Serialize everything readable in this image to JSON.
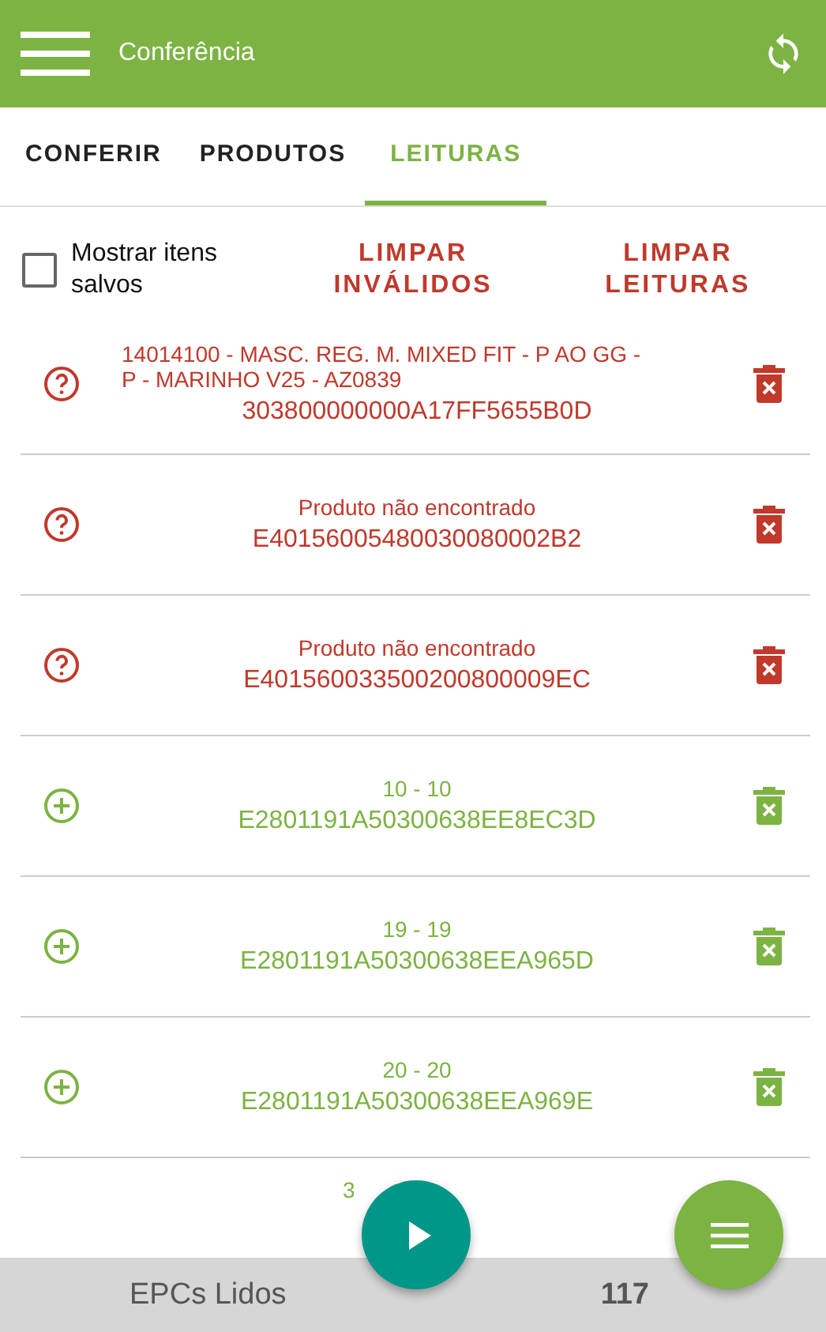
{
  "app_bar": {
    "title": "Conferência"
  },
  "tabs": [
    {
      "label": "CONFERIR",
      "selected": false
    },
    {
      "label": "PRODUTOS",
      "selected": false
    },
    {
      "label": "LEITURAS",
      "selected": true
    }
  ],
  "show_saved": {
    "label": "Mostrar itens salvos",
    "checked": false
  },
  "actions": [
    "LIMPAR INVÁLIDOS",
    "LIMPAR LEITURAS"
  ],
  "readings": [
    {
      "kind": "invalid",
      "title": "14014100 - MASC. REG. M. MIXED FIT - P AO GG - P - MARINHO V25 - AZ0839",
      "epc": "303800000000A17FF5655B0D"
    },
    {
      "kind": "invalid",
      "title": "Produto não encontrado",
      "epc": "E40156005480030080002B2"
    },
    {
      "kind": "invalid",
      "title": "Produto não encontrado",
      "epc": "E401560033500200800009EC"
    },
    {
      "kind": "valid",
      "title": "10 - 10",
      "epc": "E2801191A50300638EE8EC3D"
    },
    {
      "kind": "valid",
      "title": "19 - 19",
      "epc": "E2801191A50300638EEA965D"
    },
    {
      "kind": "valid",
      "title": "20 - 20",
      "epc": "E2801191A50300638EEA969E"
    },
    {
      "kind": "cut",
      "title": "3"
    }
  ],
  "footer": {
    "label": "EPCs Lidos",
    "count": "117"
  }
}
